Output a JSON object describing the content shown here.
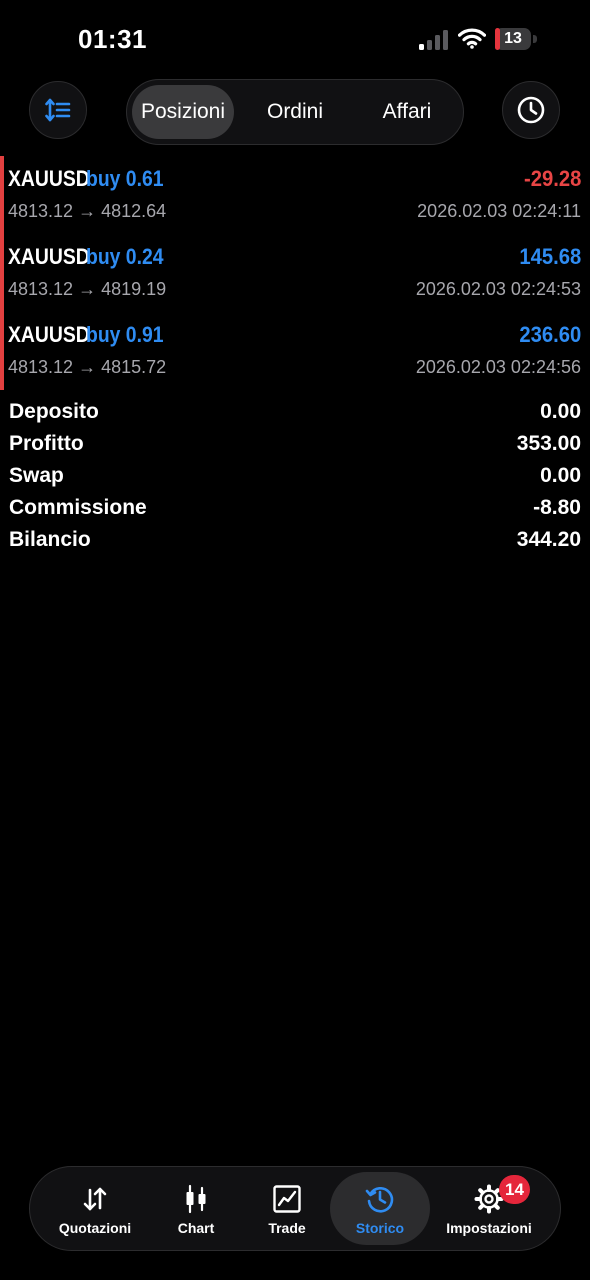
{
  "status_bar": {
    "time": "01:31",
    "battery_level": "13",
    "battery_fraction": 0.13,
    "battery_color": "#e5343d",
    "signal_bars_active": 1,
    "signal_bars_total": 4
  },
  "toolbar": {
    "sort_icon": "sort-icon",
    "history_period_icon": "clock-icon",
    "segments": [
      {
        "label": "Posizioni",
        "active": true
      },
      {
        "label": "Ordini",
        "active": false
      },
      {
        "label": "Affari",
        "active": false
      }
    ]
  },
  "positions": [
    {
      "symbol": "XAUUSD",
      "type_volume": "buy 0.61",
      "profit": "-29.28",
      "profit_sign": "negative",
      "prices": "4813.12 → 4812.64",
      "time": "2026.02.03 02:24:11"
    },
    {
      "symbol": "XAUUSD",
      "type_volume": "buy 0.24",
      "profit": "145.68",
      "profit_sign": "positive",
      "prices": "4813.12 → 4819.19",
      "time": "2026.02.03 02:24:53"
    },
    {
      "symbol": "XAUUSD",
      "type_volume": "buy 0.91",
      "profit": "236.60",
      "profit_sign": "positive",
      "prices": "4813.12 → 4815.72",
      "time": "2026.02.03 02:24:56"
    }
  ],
  "summary": [
    {
      "label": "Deposito",
      "value": "0.00"
    },
    {
      "label": "Profitto",
      "value": "353.00"
    },
    {
      "label": "Swap",
      "value": "0.00"
    },
    {
      "label": "Commissione",
      "value": "-8.80"
    },
    {
      "label": "Bilancio",
      "value": "344.20"
    }
  ],
  "tab_bar": {
    "tabs": [
      {
        "label": "Quotazioni",
        "icon": "arrows-up-down-icon",
        "active": false
      },
      {
        "label": "Chart",
        "icon": "candlestick-icon",
        "active": false
      },
      {
        "label": "Trade",
        "icon": "trade-chart-icon",
        "active": false
      },
      {
        "label": "Storico",
        "icon": "history-icon",
        "active": true
      },
      {
        "label": "Impostazioni",
        "icon": "gear-icon",
        "active": false,
        "badge": "14"
      }
    ]
  },
  "colors": {
    "background": "#000000",
    "accent_blue": "#2f8cf2",
    "loss_red": "#e84545",
    "secondary_text": "#a7a7ad",
    "badge_red": "#e5263b"
  }
}
